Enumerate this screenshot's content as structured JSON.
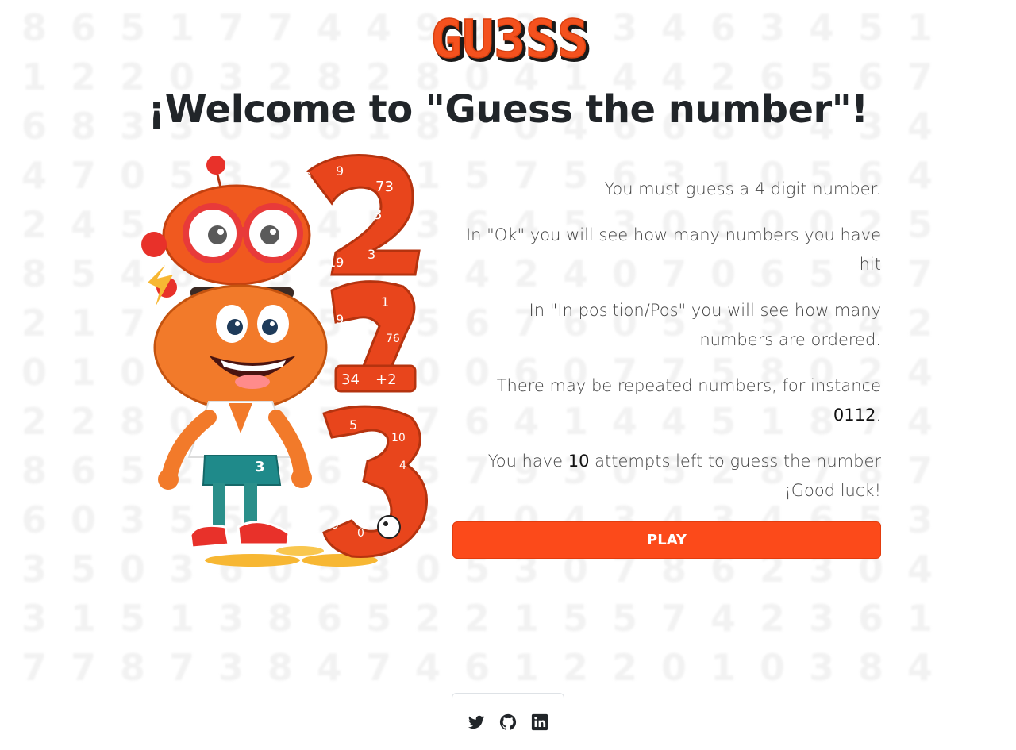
{
  "header": {
    "logo_text": "GU3SS",
    "title": "¡Welcome to \"Guess the number\"!"
  },
  "rules": {
    "line1": "You must guess a 4 digit number.",
    "line2": "In \"Ok\" you will see how many numbers you have hit",
    "line3": "In \"In position/Pos\" you will see how many numbers are ordered.",
    "line4_prefix": "There may be repeated numbers, for instance ",
    "line4_example": "0112",
    "line4_suffix": ".",
    "line5_prefix": "You have ",
    "attempts": "10",
    "line5_suffix": " attempts left to guess the number ¡Good luck!"
  },
  "play_button": {
    "label": "PLAY"
  },
  "social": {
    "items": [
      "twitter-icon",
      "github-icon",
      "linkedin-icon"
    ]
  },
  "colors": {
    "accent": "#fc4a1a",
    "logo": "#f4511e",
    "text": "#212529"
  },
  "background_digits": [
    "8651774499313463451",
    "1220328280414426567",
    "6833056187046686434",
    "4705329015756310564",
    "2457304536453060025",
    "8546732754240706587",
    "2178505556760535842",
    "0108373000607758024",
    "2280635476414451874",
    "8652436557930528787",
    "6035542534043434653",
    "3503605305307862304",
    "3151386522155742361",
    "7787384746122010384"
  ]
}
